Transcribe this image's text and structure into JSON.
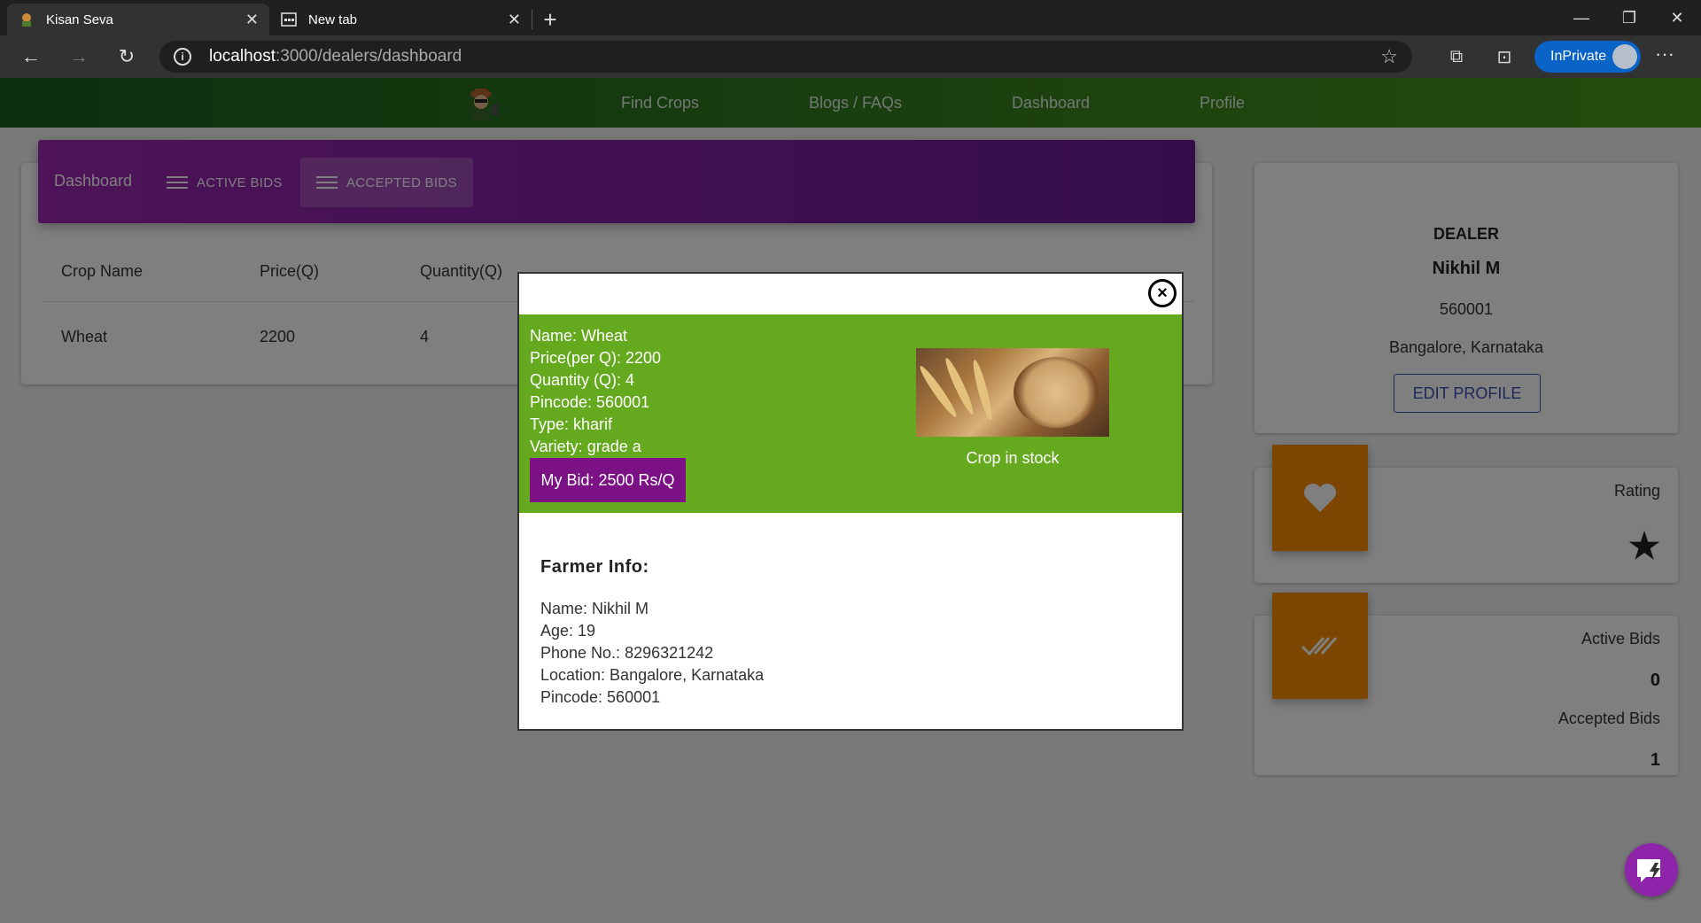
{
  "browser": {
    "tabs": [
      {
        "title": "Kisan Seva"
      },
      {
        "title": "New tab"
      }
    ],
    "url_host": "localhost",
    "url_path": ":3000/dealers/dashboard",
    "inprivate_label": "InPrivate"
  },
  "nav": {
    "links": [
      "Find Crops",
      "Blogs / FAQs",
      "Dashboard",
      "Profile"
    ]
  },
  "dashboard": {
    "title": "Dashboard",
    "tabs": [
      "ACTIVE BIDS",
      "ACCEPTED BIDS"
    ],
    "table": {
      "headers": [
        "Crop Name",
        "Price(Q)",
        "Quantity(Q)"
      ],
      "rows": [
        [
          "Wheat",
          "2200",
          "4"
        ]
      ]
    }
  },
  "profile": {
    "role": "DEALER",
    "name": "Nikhil M",
    "pincode": "560001",
    "location": "Bangalore, Karnataka",
    "edit_label": "EDIT PROFILE"
  },
  "stats": {
    "rating_label": "Rating",
    "rating_value": "★",
    "active_label": "Active Bids",
    "active_value": "0",
    "accepted_label": "Accepted Bids",
    "accepted_value": "1"
  },
  "modal": {
    "crop_lines": [
      "Name: Wheat",
      "Price(per Q): 2200",
      "Quantity (Q): 4",
      "Pincode: 560001",
      "Type: kharif",
      "Variety: grade a"
    ],
    "my_bid": "My Bid: 2500 Rs/Q",
    "stock_status": "Crop in stock",
    "farmer_title": "Farmer Info:",
    "farmer_lines": [
      "Name: Nikhil M",
      "Age: 19",
      "Phone No.: 8296321242",
      "Location: Bangalore, Karnataka",
      "Pincode: 560001"
    ],
    "close_symbol": "×"
  },
  "colors": {
    "nav_green": "#1b5e20",
    "purple": "#9c27b0",
    "modal_green": "#65a91f",
    "bid_purple": "#7b1185",
    "stat_orange": "#fb8c00"
  }
}
